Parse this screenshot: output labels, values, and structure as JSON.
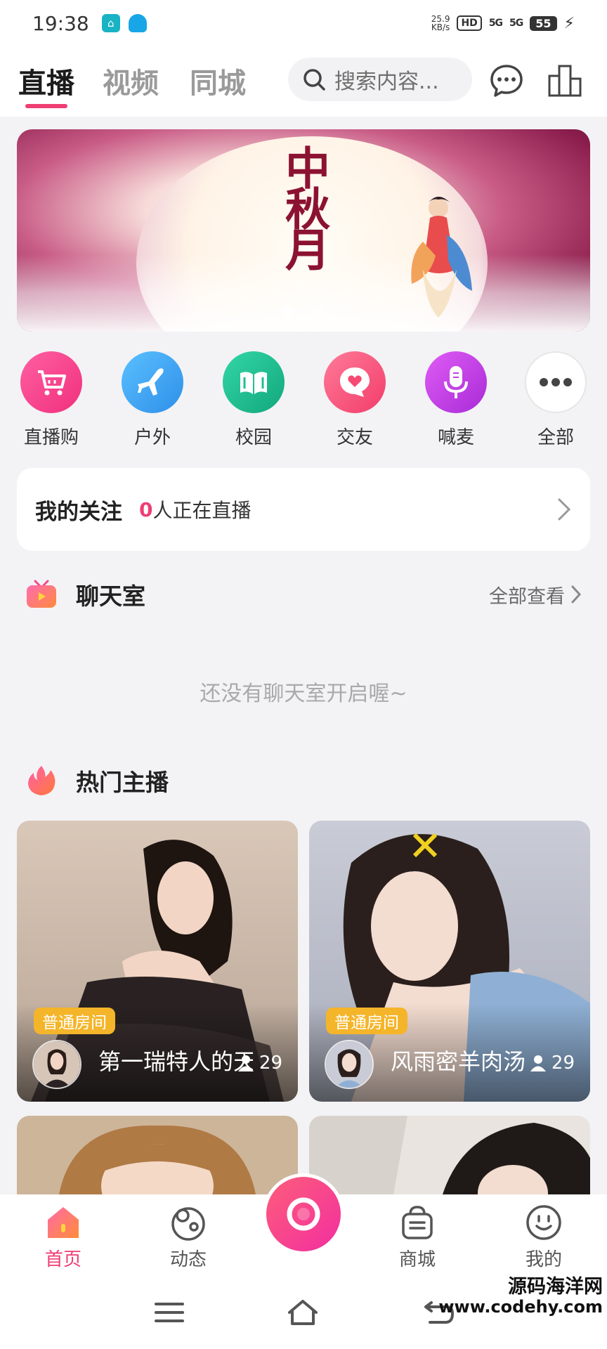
{
  "status_bar": {
    "time": "19:38",
    "speed_value": "25.9",
    "speed_unit": "KB/s",
    "hd_label": "HD",
    "net1": "5G",
    "net2": "5G",
    "battery": "55"
  },
  "header": {
    "tabs": [
      {
        "label": "直播",
        "active": true
      },
      {
        "label": "视频",
        "active": false
      },
      {
        "label": "同城",
        "active": false
      }
    ],
    "search_placeholder": "搜索内容..."
  },
  "banner": {
    "title": "中秋月",
    "dots": 2,
    "active_dot": 0
  },
  "categories": [
    {
      "label": "直播购",
      "icon": "cart-icon",
      "color": "#f2398b"
    },
    {
      "label": "户外",
      "icon": "plane-icon",
      "color": "#3aa0f0"
    },
    {
      "label": "校园",
      "icon": "book-icon",
      "color": "#1fbf94"
    },
    {
      "label": "交友",
      "icon": "heart-chat-icon",
      "color": "#f64a72"
    },
    {
      "label": "喊麦",
      "icon": "microphone-icon",
      "color": "#c13ee3"
    },
    {
      "label": "全部",
      "icon": "more-icon",
      "color": "#ffffff"
    }
  ],
  "follow": {
    "title": "我的关注",
    "count": "0",
    "suffix": "人正在直播"
  },
  "chatroom": {
    "title": "聊天室",
    "more": "全部查看",
    "empty_text": "还没有聊天室开启喔~"
  },
  "hot": {
    "title": "热门主播",
    "cards": [
      {
        "tag": "普通房间",
        "name": "第一瑞特人的天",
        "viewers": "29"
      },
      {
        "tag": "普通房间",
        "name": "风雨密羊肉汤",
        "viewers": "29"
      }
    ]
  },
  "bottom_nav": {
    "items": [
      {
        "label": "首页",
        "active": true
      },
      {
        "label": "动态",
        "active": false
      },
      {
        "label": "商城",
        "active": false
      },
      {
        "label": "我的",
        "active": false
      }
    ]
  },
  "watermark": {
    "line1": "源码海洋网",
    "line2": "www.codehy.com"
  },
  "colors": {
    "accent": "#ef3e74",
    "tag": "#f4b52a",
    "background": "#f3f3f5"
  }
}
